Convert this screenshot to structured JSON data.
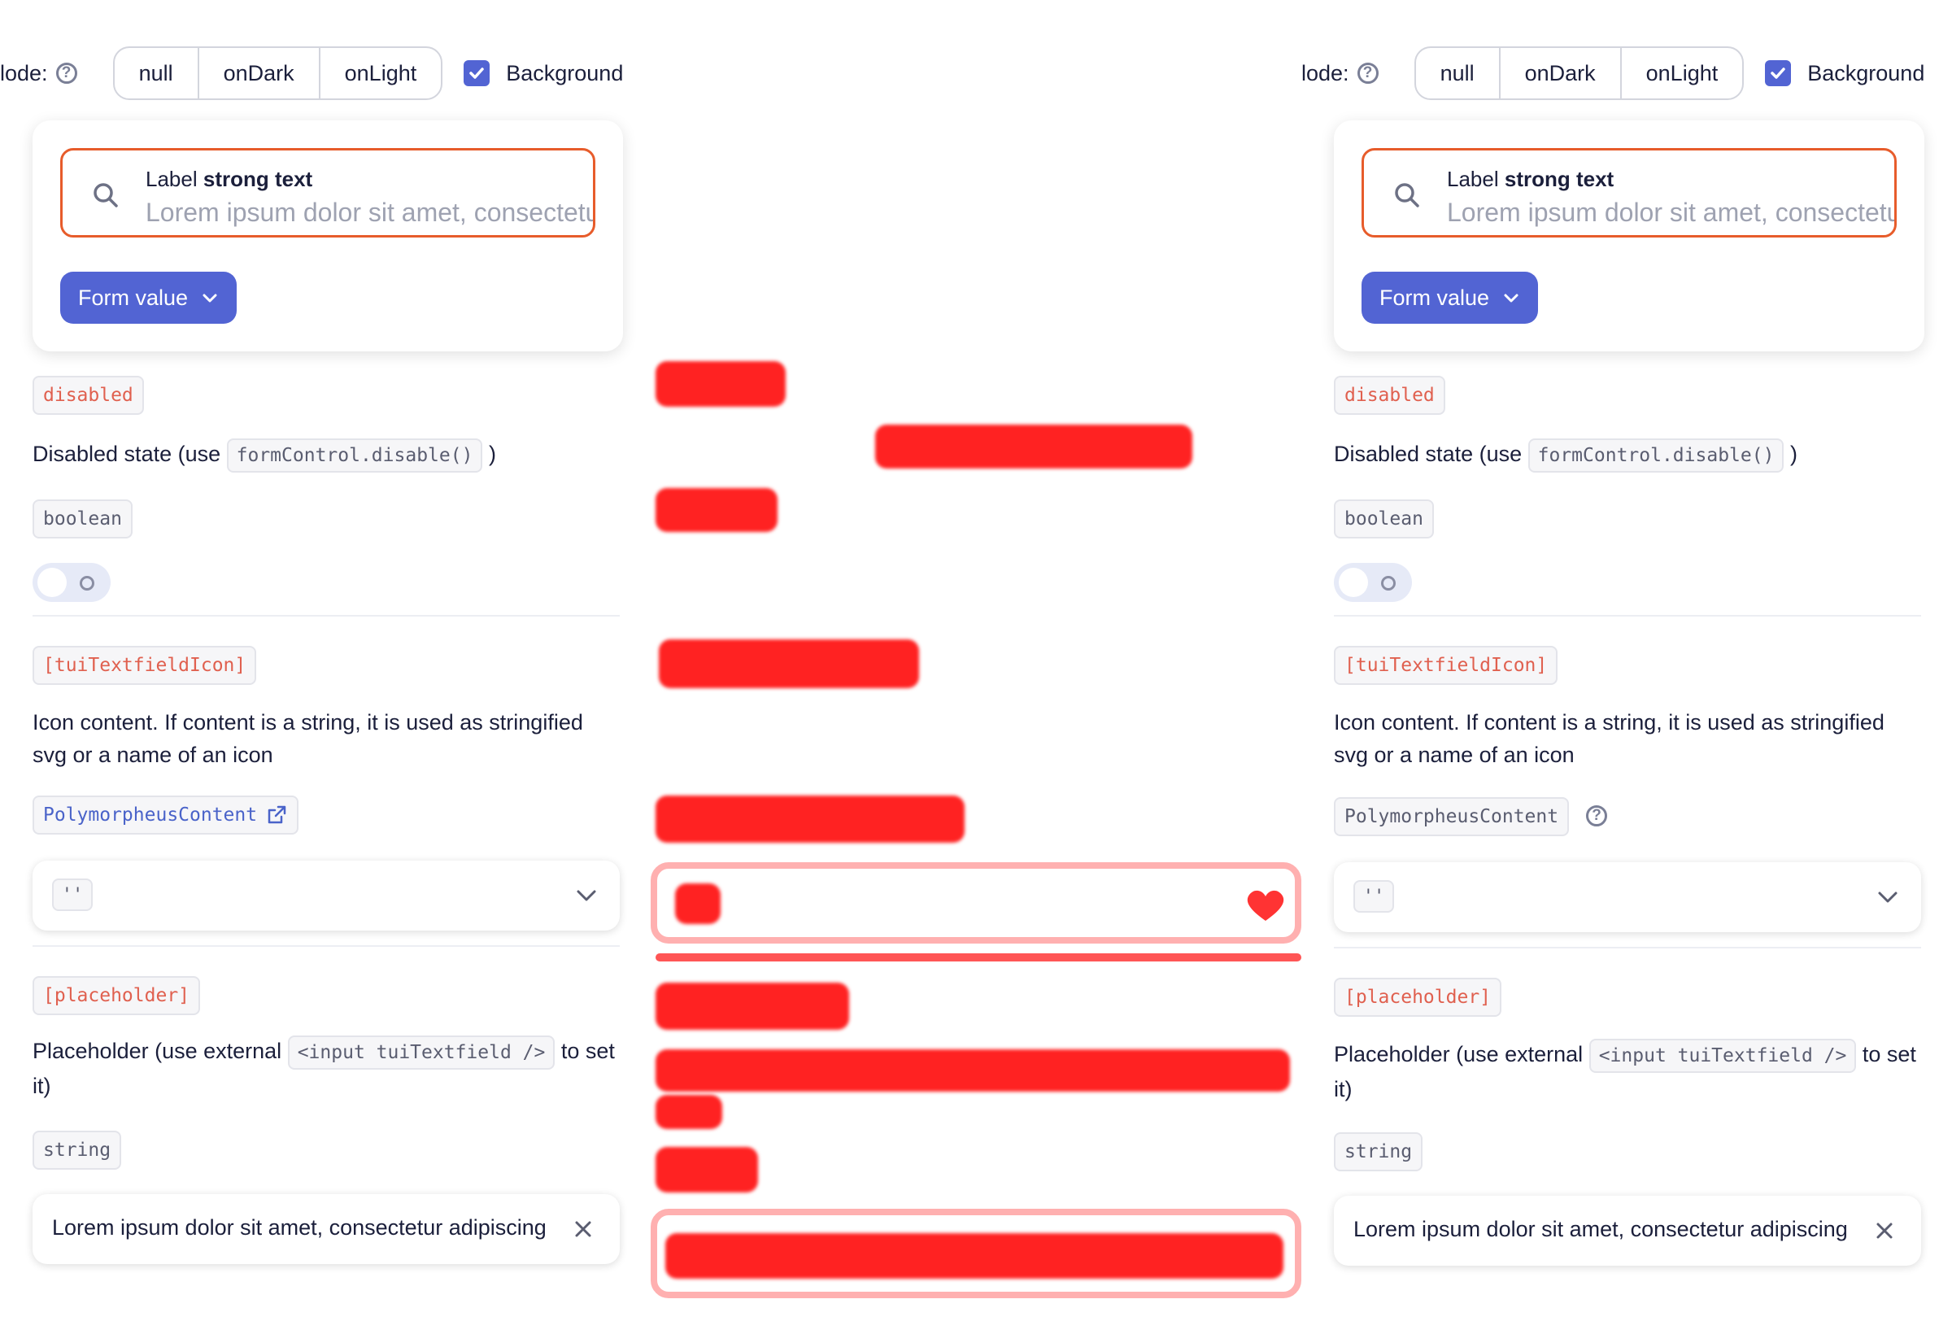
{
  "header": {
    "mode_label": "lode:",
    "mode_options": [
      "null",
      "onDark",
      "onLight"
    ],
    "background_label": "Background"
  },
  "textfield": {
    "label_prefix": "Label",
    "label_strong": "strong text",
    "value": "Lorem ipsum dolor sit amet, consectetur"
  },
  "form_button_label": "Form value",
  "disabled": {
    "tag": "disabled",
    "desc_pre": "Disabled state (use",
    "desc_code": "formControl.disable()",
    "desc_post": ")",
    "type": "boolean",
    "toggle_on": false
  },
  "icon": {
    "tag": "[tuiTextfieldIcon]",
    "desc": "Icon content. If content is a string, it is used as stringified svg or a name of an icon",
    "type": "PolymorpheusContent",
    "select_value": "''"
  },
  "placeholder": {
    "tag": "[placeholder]",
    "desc_pre": "Placeholder (use external",
    "desc_code": "<input tuiTextfield />",
    "desc_post": "to set it)",
    "type": "string",
    "value": "Lorem ipsum dolor sit amet, consectetur adipiscing"
  },
  "colors": {
    "accent": "#5264d3",
    "focus_border": "#e75c2b",
    "tag_red": "#e0604f",
    "tag_blue": "#4a63c9"
  }
}
